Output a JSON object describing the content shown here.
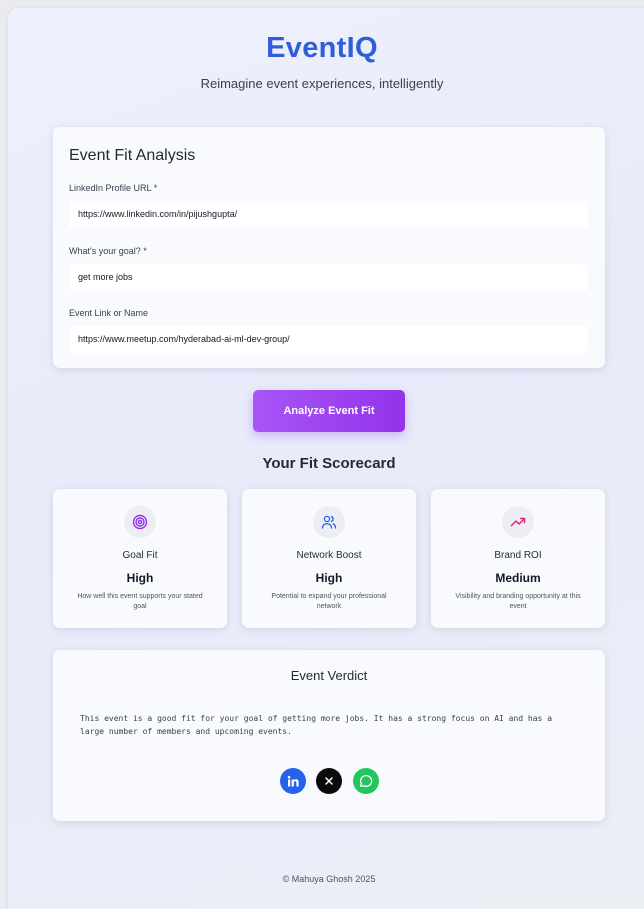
{
  "header": {
    "brand": "EventIQ",
    "tagline": "Reimagine event experiences, intelligently"
  },
  "form": {
    "title": "Event Fit Analysis",
    "fields": [
      {
        "label": "LinkedIn Profile URL *",
        "value": "https://www.linkedin.com/in/pijushgupta/"
      },
      {
        "label": "What's your goal? *",
        "value": "get more jobs"
      },
      {
        "label": "Event Link or Name",
        "value": "https://www.meetup.com/hyderabad-ai-ml-dev-group/"
      }
    ]
  },
  "analyze_button": {
    "label": "Analyze Event Fit"
  },
  "scorecard": {
    "title": "Your Fit Scorecard",
    "cards": [
      {
        "icon": "target-icon",
        "name": "Goal Fit",
        "value": "High",
        "desc": "How well this event supports your stated goal",
        "icon_color": "#9333ea"
      },
      {
        "icon": "users-icon",
        "name": "Network Boost",
        "value": "High",
        "desc": "Potential to expand your professional network",
        "icon_color": "#2563eb"
      },
      {
        "icon": "trending-up-icon",
        "name": "Brand ROI",
        "value": "Medium",
        "desc": "Visibility and branding opportunity at this event",
        "icon_color": "#db2777"
      }
    ]
  },
  "verdict": {
    "title": "Event Verdict",
    "text": "This event is a good fit for your goal of getting more jobs. It has a strong focus on AI and has a large number of members and upcoming events.",
    "share": [
      {
        "icon": "linkedin-icon",
        "color": "#2563eb"
      },
      {
        "icon": "x-icon",
        "color": "#0b0b0b"
      },
      {
        "icon": "whatsapp-icon",
        "color": "#22c55e"
      }
    ]
  },
  "footer": {
    "text": "© Mahuya Ghosh 2025"
  },
  "colors": {
    "brand": "#2f5fd8",
    "button": "#a855f7"
  }
}
